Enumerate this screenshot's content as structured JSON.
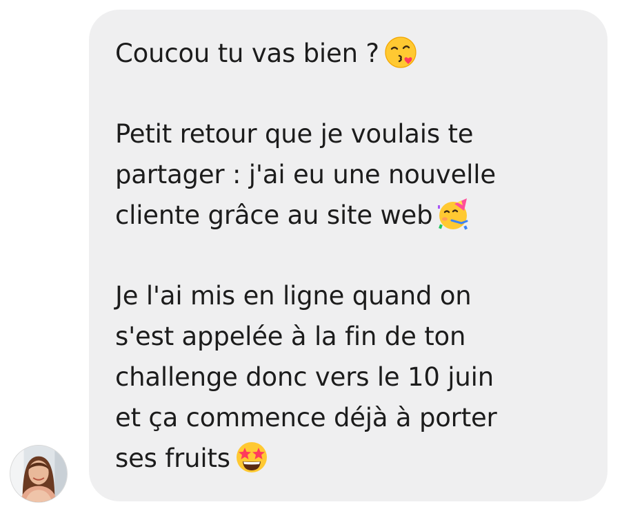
{
  "message": {
    "paragraphs": [
      {
        "lines": [
          "Coucou tu vas bien ?"
        ],
        "emoji": "face-blowing-kiss-icon"
      },
      {
        "lines": [
          "Petit retour que je voulais te",
          "partager : j'ai eu une nouvelle",
          "cliente grâce au site web"
        ],
        "emoji": "partying-face-icon"
      },
      {
        "lines": [
          "Je l'ai mis en ligne quand on",
          "s'est appelée à la fin de ton",
          "challenge donc vers le 10 juin",
          "et ça commence déjà à porter",
          "ses fruits"
        ],
        "emoji": "star-struck-icon"
      }
    ],
    "bubble_color": "#efeff0",
    "text_color": "#1c1c1c"
  },
  "sender": {
    "avatar": "avatar-photo"
  }
}
